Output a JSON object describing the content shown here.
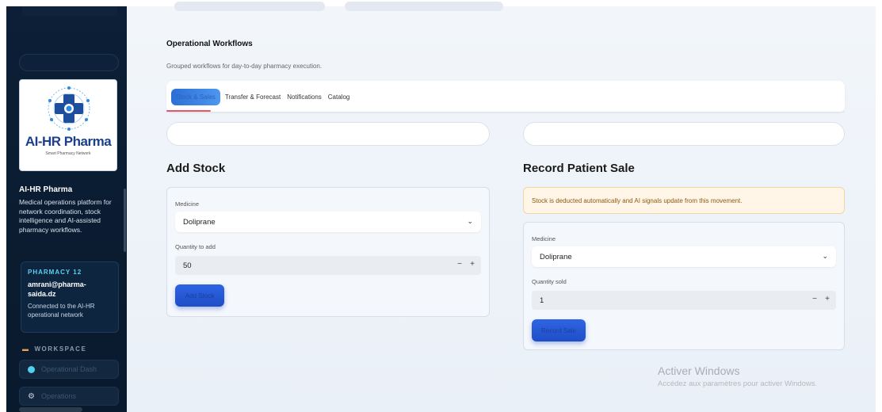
{
  "sidebar": {
    "brand_logo_title": "AI-HR Pharma",
    "brand_logo_subtitle": "Smart Pharmacy Network",
    "brand_name": "AI-HR Pharma",
    "brand_description": "Medical operations platform for network coordination, stock intelligence and AI-assisted pharmacy workflows.",
    "pharmacy_badge": "PHARMACY 12",
    "pharmacy_email": "amrani@pharma-saida.dz",
    "pharmacy_status": "Connected to the AI-HR operational network",
    "workspace_heading": "WORKSPACE",
    "nav_items": [
      {
        "label": "Operational Dash",
        "icon": "dot-icon"
      },
      {
        "label": "Operations",
        "icon": "gear-icon"
      }
    ]
  },
  "main": {
    "section_title": "Operational Workflows",
    "section_subtitle": "Grouped workflows for day-to-day pharmacy execution.",
    "tabs": [
      {
        "label": "Stock & Sales",
        "active": true
      },
      {
        "label": "Transfer & Forecast",
        "active": false
      },
      {
        "label": "Notifications",
        "active": false
      },
      {
        "label": "Catalog",
        "active": false
      }
    ],
    "add_stock": {
      "heading": "Add Stock",
      "medicine_label": "Medicine",
      "medicine_value": "Doliprane",
      "quantity_label": "Quantity to add",
      "quantity_value": "50",
      "button_label": "Add Stock"
    },
    "record_sale": {
      "heading": "Record Patient Sale",
      "notice": "Stock is deducted automatically and AI signals update from this movement.",
      "medicine_label": "Medicine",
      "medicine_value": "Doliprane",
      "quantity_label": "Quantity sold",
      "quantity_value": "1",
      "button_label": "Record Sale"
    }
  },
  "watermark": {
    "title": "Activer Windows",
    "subtitle": "Accédez aux paramètres pour activer Windows."
  },
  "colors": {
    "sidebar_bg": "#0c1f36",
    "accent_blue": "#2b6fd6",
    "tab_underline": "#e8556a",
    "notice_bg": "#fff6e8"
  }
}
